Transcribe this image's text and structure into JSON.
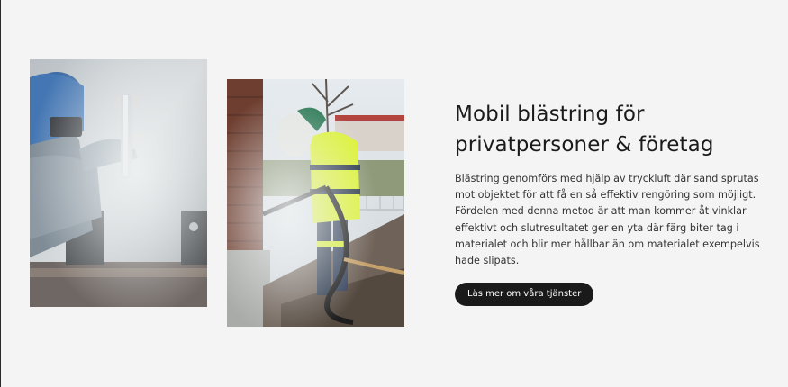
{
  "section": {
    "heading_line1": "Mobil blästring för",
    "heading_line2": "privatpersoner & företag",
    "paragraph": "Blästring genomförs med hjälp av tryckluft där sand sprutas mot objektet för att få en så effektiv rengöring som möjligt. Fördelen med denna metod är att man kommer åt vinklar effektivt och slutresultatet ger en yta där färg biter tag i materialet och blir mer hållbar än om materialet exempelvis hade slipats.",
    "cta_label": "Läs mer om våra tjänster"
  },
  "colors": {
    "background": "#f4f4f4",
    "heading": "#1b1b1b",
    "text": "#333333",
    "button_bg": "#1a1a1a",
    "button_text": "#ffffff"
  }
}
